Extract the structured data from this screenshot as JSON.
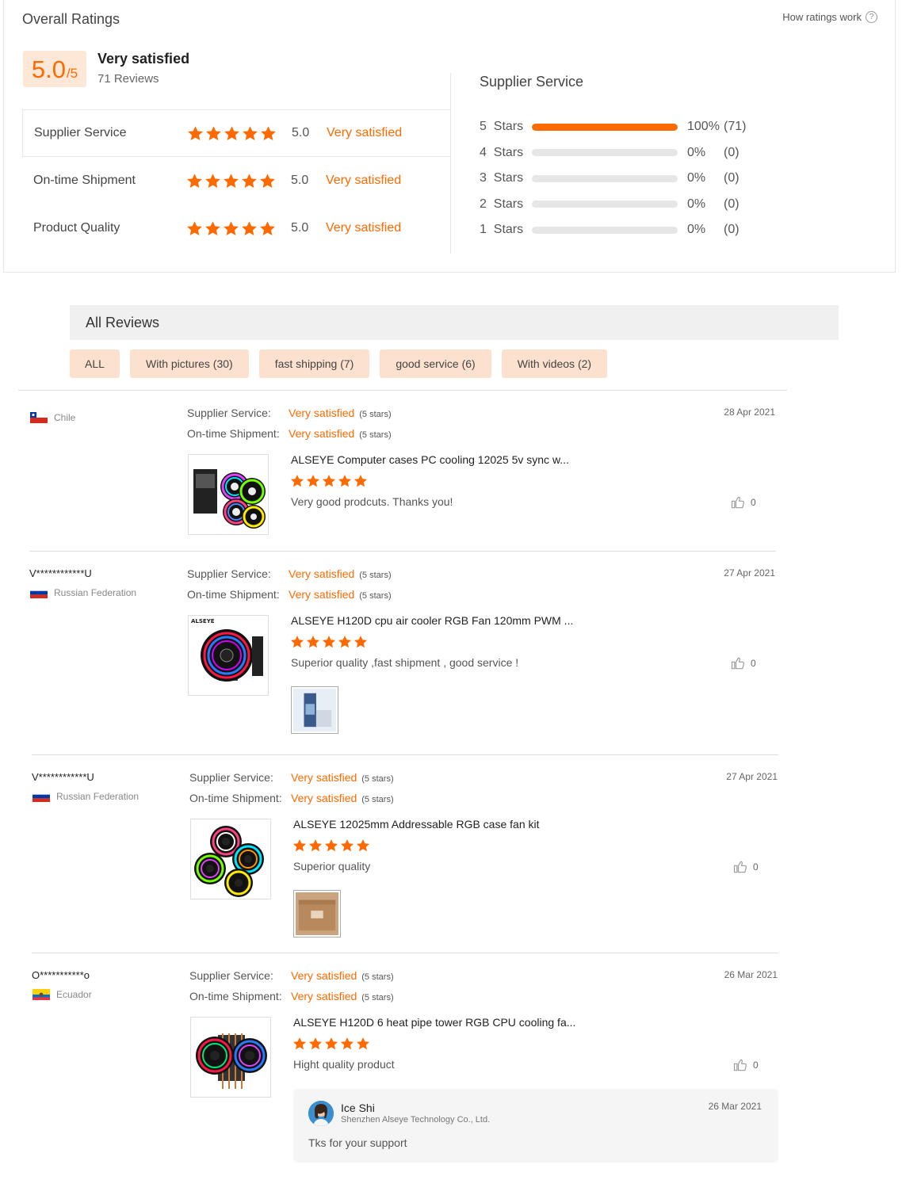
{
  "overall": {
    "title": "Overall Ratings",
    "how_link": "How ratings work",
    "help_icon": "?",
    "score": "5.0",
    "score_max": "/5",
    "satisfaction": "Very satisfied",
    "reviews_count": "71 Reviews",
    "categories": [
      {
        "name": "Supplier Service",
        "value": "5.0",
        "label": "Very satisfied",
        "stars": 5
      },
      {
        "name": "On-time Shipment",
        "value": "5.0",
        "label": "Very satisfied",
        "stars": 5
      },
      {
        "name": "Product Quality",
        "value": "5.0",
        "label": "Very satisfied",
        "stars": 5
      }
    ],
    "distribution_title": "Supplier Service",
    "distribution": [
      {
        "label": "5  Stars",
        "fraction": 1.0,
        "pct": "100%",
        "count": "(71)"
      },
      {
        "label": "4  Stars",
        "fraction": 0,
        "pct": "0%",
        "count": "(0)"
      },
      {
        "label": "3  Stars",
        "fraction": 0,
        "pct": "0%",
        "count": "(0)"
      },
      {
        "label": "2  Stars",
        "fraction": 0,
        "pct": "0%",
        "count": "(0)"
      },
      {
        "label": "1  Stars",
        "fraction": 0,
        "pct": "0%",
        "count": "(0)"
      }
    ]
  },
  "all_reviews": {
    "title": "All Reviews",
    "filters": [
      "ALL",
      "With pictures (30)",
      "fast shipping (7)",
      "good service (6)",
      "With videos (2)"
    ]
  },
  "labels": {
    "supplier_service": "Supplier Service:",
    "on_time_shipment": "On-time Shipment:",
    "very_satisfied": "Very satisfied",
    "five_stars": "(5 stars)"
  },
  "reviews": [
    {
      "user": "",
      "country": "Chile",
      "date": "28 Apr 2021",
      "product": "ALSEYE Computer cases PC cooling 12025 5v sync w...",
      "rating": 5,
      "text": "Very good prodcuts. Thanks you!",
      "likes": "0"
    },
    {
      "user": "V************U",
      "country": "Russian Federation",
      "date": "27 Apr 2021",
      "product": "ALSEYE H120D cpu air cooler RGB Fan 120mm PWM ...",
      "rating": 5,
      "text": "Superior quality ,fast shipment , good service !",
      "likes": "0"
    },
    {
      "user": "V************U",
      "country": "Russian Federation",
      "date": "27 Apr 2021",
      "product": "ALSEYE 12025mm Addressable RGB case fan kit",
      "rating": 5,
      "text": "Superior quality",
      "likes": "0"
    },
    {
      "user": "O***********o",
      "country": "Ecuador",
      "date": "26 Mar 2021",
      "product": "ALSEYE H120D 6 heat pipe tower RGB CPU cooling fa...",
      "rating": 5,
      "text": "Hight quality product",
      "likes": "0",
      "reply": {
        "name": "Ice Shi",
        "company": "Shenzhen Alseye Technology Co., Ltd.",
        "date": "26 Mar 2021",
        "text": "Tks for your support"
      }
    }
  ],
  "colors": {
    "accent": "#ff6a00",
    "accent_bg": "#fde7d6"
  }
}
